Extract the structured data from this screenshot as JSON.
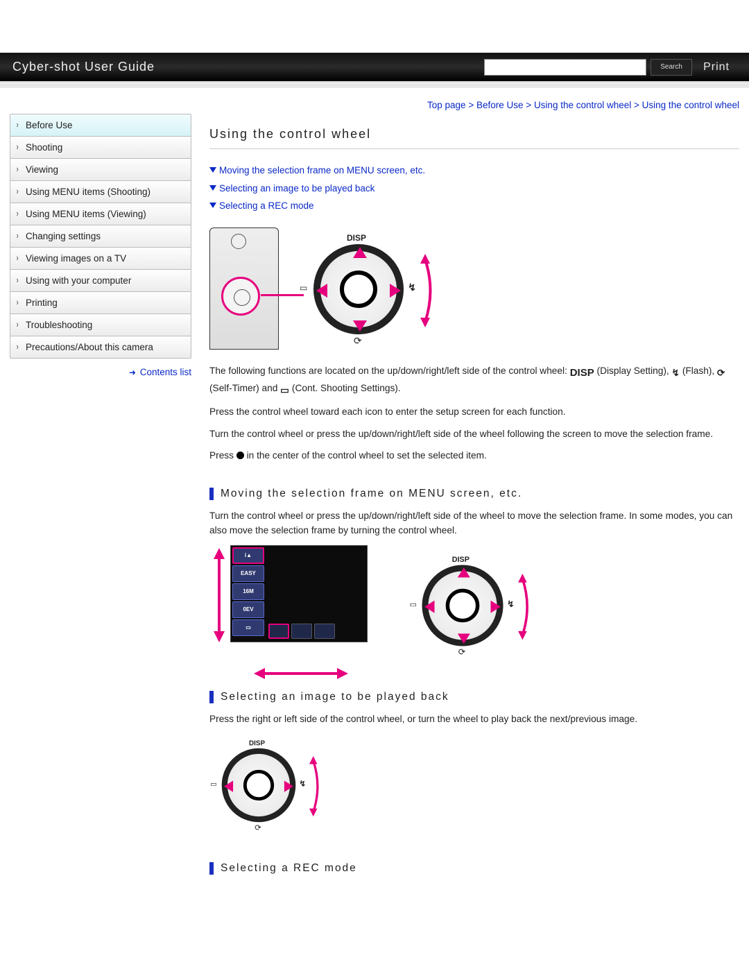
{
  "header": {
    "title": "Cyber-shot User Guide",
    "search_btn": "Search",
    "print_btn": "Print",
    "search_placeholder": ""
  },
  "breadcrumb": {
    "parts": [
      "Top page",
      "Before Use",
      "Using the control wheel",
      "Using the control wheel"
    ]
  },
  "sidebar": {
    "items": [
      {
        "label": "Before Use",
        "active": true
      },
      {
        "label": "Shooting"
      },
      {
        "label": "Viewing"
      },
      {
        "label": "Using MENU items (Shooting)"
      },
      {
        "label": "Using MENU items (Viewing)"
      },
      {
        "label": "Changing settings"
      },
      {
        "label": "Viewing images on a TV"
      },
      {
        "label": "Using with your computer"
      },
      {
        "label": "Printing"
      },
      {
        "label": "Troubleshooting"
      },
      {
        "label": "Precautions/About this camera"
      }
    ],
    "contents_link": "Contents list"
  },
  "main": {
    "title": "Using the control wheel",
    "toc": [
      "Moving the selection frame on MENU screen, etc.",
      "Selecting an image to be played back",
      "Selecting a REC mode"
    ],
    "p1a": "The following functions are located on the up/down/right/left side of the control wheel: ",
    "p1b": " (Display Setting), ",
    "p1c": " (Flash), ",
    "p1d": " (Self-Timer) and ",
    "p1e": " (Cont. Shooting Settings).",
    "p2": "Press the control wheel toward each icon to enter the setup screen for each function.",
    "p3": "Turn the control wheel or press the up/down/right/left side of the wheel following the screen to move the selection frame.",
    "p4a": "Press ",
    "p4b": " in the center of the control wheel to set the selected item.",
    "sec1_title": "Moving the selection frame on MENU screen, etc.",
    "sec1_body": "Turn the control wheel or press the up/down/right/left side of the wheel to move the selection frame. In some modes, you can also move the selection frame by turning the control wheel.",
    "sec2_title": "Selecting an image to be played back",
    "sec2_body": "Press the right or left side of the control wheel, or turn the wheel to play back the next/previous image.",
    "sec3_title": "Selecting a REC mode",
    "icons": {
      "disp": "DISP",
      "flash": "↯",
      "timer": "⟳",
      "cont": "▭",
      "play": "▭",
      "dot": "●"
    },
    "menu_labels": [
      "i▲",
      "EASY",
      "16M",
      "0EV",
      "▭"
    ]
  }
}
